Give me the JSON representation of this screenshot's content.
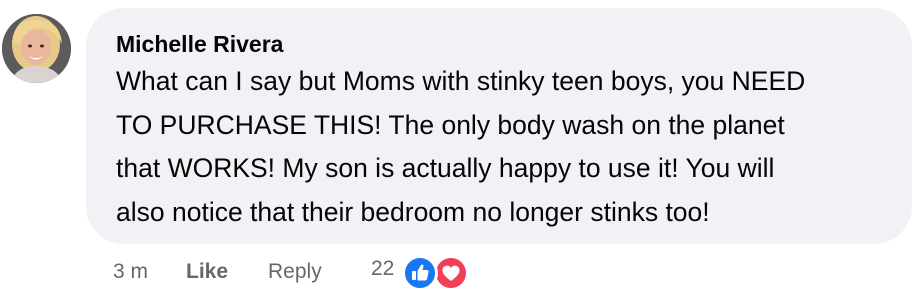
{
  "comment": {
    "author": "Michelle Rivera",
    "lines": [
      "What can I say but Moms with stinky teen boys, you NEED",
      "TO PURCHASE THIS! The only body wash on the planet",
      "that WORKS! My son is actually happy to use it! You will",
      "also notice that their bedroom no longer stinks too!"
    ]
  },
  "actions": {
    "time": "3 m",
    "like_label": "Like",
    "reply_label": "Reply",
    "reaction_count": "22",
    "reactions": [
      "like-icon",
      "love-icon"
    ]
  },
  "colors": {
    "bubble_bg": "#f0f2f5",
    "text": "#050505",
    "meta": "#65676b",
    "like_blue": "#1877f2",
    "love_red": "#f33e58"
  }
}
